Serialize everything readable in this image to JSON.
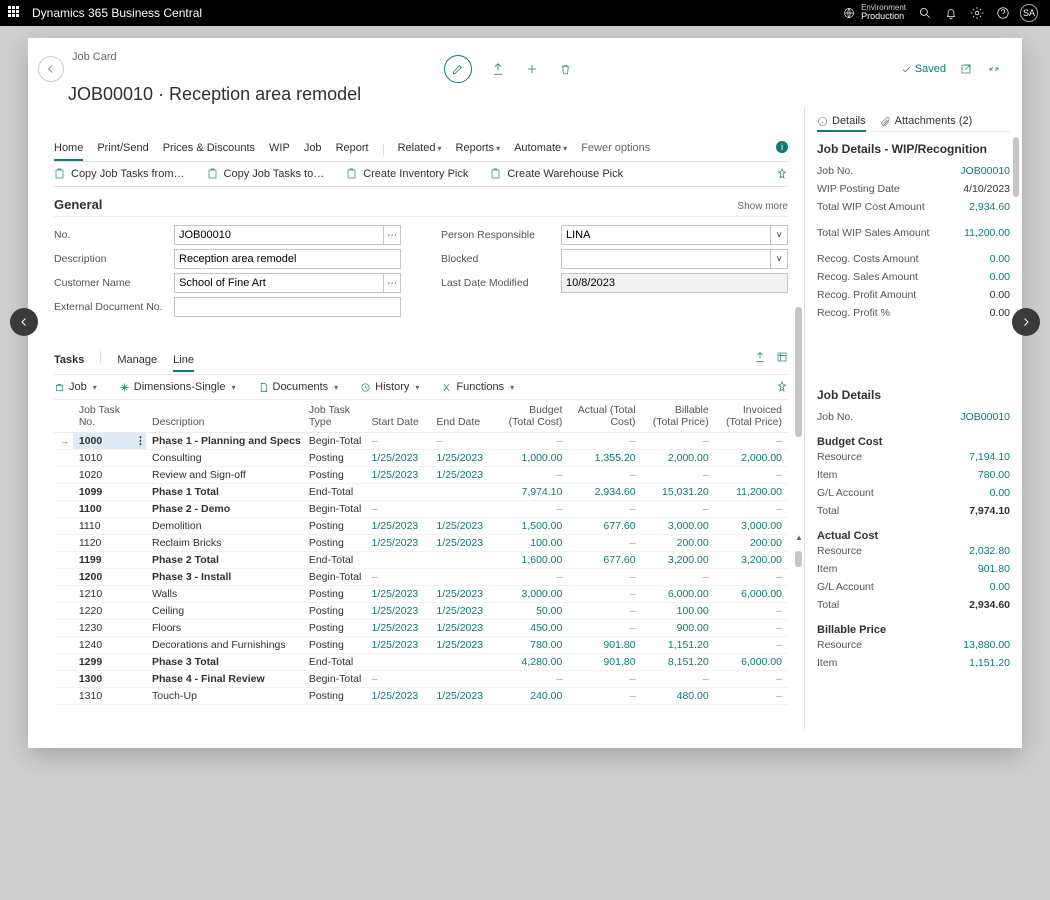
{
  "topbar": {
    "title": "Dynamics 365 Business Central",
    "env_label": "Environment",
    "env_value": "Production",
    "avatar": "SA"
  },
  "header": {
    "breadcrumb": "Job Card",
    "page_title": "JOB00010 · Reception area remodel",
    "saved": "Saved"
  },
  "tabs": [
    "Home",
    "Print/Send",
    "Prices & Discounts",
    "WIP",
    "Job",
    "Report"
  ],
  "tabs_right": [
    "Related",
    "Reports",
    "Automate"
  ],
  "fewer_options": "Fewer options",
  "actions": [
    "Copy Job Tasks from…",
    "Copy Job Tasks to…",
    "Create Inventory Pick",
    "Create Warehouse Pick"
  ],
  "general": {
    "title": "General",
    "show_more": "Show more",
    "no_label": "No.",
    "no_value": "JOB00010",
    "description_label": "Description",
    "description_value": "Reception area remodel",
    "customer_label": "Customer Name",
    "customer_value": "School of Fine Art",
    "ext_doc_label": "External Document No.",
    "ext_doc_value": "",
    "person_label": "Person Responsible",
    "person_value": "LINA",
    "blocked_label": "Blocked",
    "blocked_value": "",
    "last_mod_label": "Last Date Modified",
    "last_mod_value": "10/8/2023"
  },
  "sub_tabs": {
    "tasks": "Tasks",
    "manage": "Manage",
    "line": "Line"
  },
  "tools": [
    "Job",
    "Dimensions-Single",
    "Documents",
    "History",
    "Functions"
  ],
  "grid": {
    "headers": [
      "Job Task No.",
      "Description",
      "Job Task Type",
      "Start Date",
      "End Date",
      "Budget (Total Cost)",
      "Actual (Total Cost)",
      "Billable (Total Price)",
      "Invoiced (Total Price)"
    ],
    "rows": [
      {
        "no": "1000",
        "desc": "Phase 1 - Planning and Specs",
        "type": "Begin-Total",
        "sd": "–",
        "ed": "–",
        "b": "–",
        "a": "–",
        "bi": "–",
        "inv": "–",
        "bold": true,
        "sel": true
      },
      {
        "no": "1010",
        "desc": "Consulting",
        "type": "Posting",
        "sd": "1/25/2023",
        "ed": "1/25/2023",
        "b": "1,000.00",
        "a": "1,355.20",
        "bi": "2,000.00",
        "inv": "2,000.00"
      },
      {
        "no": "1020",
        "desc": "Review and Sign-off",
        "type": "Posting",
        "sd": "1/25/2023",
        "ed": "1/25/2023",
        "b": "–",
        "a": "–",
        "bi": "–",
        "inv": "–"
      },
      {
        "no": "1099",
        "desc": "Phase 1 Total",
        "type": "End-Total",
        "sd": "",
        "ed": "",
        "b": "7,974.10",
        "a": "2,934.60",
        "bi": "15,031.20",
        "inv": "11,200.00",
        "bold": true
      },
      {
        "no": "1100",
        "desc": "Phase 2 - Demo",
        "type": "Begin-Total",
        "sd": "–",
        "ed": "",
        "b": "–",
        "a": "–",
        "bi": "–",
        "inv": "–",
        "bold": true
      },
      {
        "no": "1110",
        "desc": "Demolition",
        "type": "Posting",
        "sd": "1/25/2023",
        "ed": "1/25/2023",
        "b": "1,500.00",
        "a": "677.60",
        "bi": "3,000.00",
        "inv": "3,000.00"
      },
      {
        "no": "1120",
        "desc": "Reclaim Bricks",
        "type": "Posting",
        "sd": "1/25/2023",
        "ed": "1/25/2023",
        "b": "100.00",
        "a": "–",
        "bi": "200.00",
        "inv": "200.00"
      },
      {
        "no": "1199",
        "desc": "Phase 2 Total",
        "type": "End-Total",
        "sd": "",
        "ed": "",
        "b": "1,600.00",
        "a": "677.60",
        "bi": "3,200.00",
        "inv": "3,200.00",
        "bold": true
      },
      {
        "no": "1200",
        "desc": "Phase 3 - Install",
        "type": "Begin-Total",
        "sd": "–",
        "ed": "",
        "b": "–",
        "a": "–",
        "bi": "–",
        "inv": "–",
        "bold": true
      },
      {
        "no": "1210",
        "desc": "Walls",
        "type": "Posting",
        "sd": "1/25/2023",
        "ed": "1/25/2023",
        "b": "3,000.00",
        "a": "–",
        "bi": "6,000.00",
        "inv": "6,000.00"
      },
      {
        "no": "1220",
        "desc": "Ceiling",
        "type": "Posting",
        "sd": "1/25/2023",
        "ed": "1/25/2023",
        "b": "50.00",
        "a": "–",
        "bi": "100.00",
        "inv": "–"
      },
      {
        "no": "1230",
        "desc": "Floors",
        "type": "Posting",
        "sd": "1/25/2023",
        "ed": "1/25/2023",
        "b": "450.00",
        "a": "–",
        "bi": "900.00",
        "inv": "–"
      },
      {
        "no": "1240",
        "desc": "Decorations and Furnishings",
        "type": "Posting",
        "sd": "1/25/2023",
        "ed": "1/25/2023",
        "b": "780.00",
        "a": "901.80",
        "bi": "1,151.20",
        "inv": "–"
      },
      {
        "no": "1299",
        "desc": "Phase 3 Total",
        "type": "End-Total",
        "sd": "",
        "ed": "",
        "b": "4,280.00",
        "a": "901.80",
        "bi": "8,151.20",
        "inv": "6,000.00",
        "bold": true
      },
      {
        "no": "1300",
        "desc": "Phase 4 - Final Review",
        "type": "Begin-Total",
        "sd": "–",
        "ed": "",
        "b": "–",
        "a": "–",
        "bi": "–",
        "inv": "–",
        "bold": true
      },
      {
        "no": "1310",
        "desc": "Touch-Up",
        "type": "Posting",
        "sd": "1/25/2023",
        "ed": "1/25/2023",
        "b": "240.00",
        "a": "–",
        "bi": "480.00",
        "inv": "–"
      }
    ]
  },
  "side": {
    "details_tab": "Details",
    "attachments_tab": "Attachments (2)",
    "wip_title": "Job Details - WIP/Recognition",
    "wip": [
      {
        "k": "Job No.",
        "v": "JOB00010",
        "link": true
      },
      {
        "k": "WIP Posting Date",
        "v": "4/10/2023"
      },
      {
        "k": "Total WIP Cost Amount",
        "v": "2,934.60",
        "link": true
      },
      {
        "k": "Total WIP Sales Amount",
        "v": "11,200.00",
        "link": true,
        "gap": true
      },
      {
        "k": "Recog. Costs Amount",
        "v": "0.00",
        "link": true,
        "gap": true
      },
      {
        "k": "Recog. Sales Amount",
        "v": "0.00",
        "link": true
      },
      {
        "k": "Recog. Profit Amount",
        "v": "0.00"
      },
      {
        "k": "Recog. Profit %",
        "v": "0.00"
      }
    ],
    "jd_title": "Job Details",
    "jd_jobno_k": "Job No.",
    "jd_jobno_v": "JOB00010",
    "budget_title": "Budget Cost",
    "budget": [
      {
        "k": "Resource",
        "v": "7,194.10",
        "link": true
      },
      {
        "k": "Item",
        "v": "780.00",
        "link": true
      },
      {
        "k": "G/L Account",
        "v": "0.00",
        "link": true
      },
      {
        "k": "Total",
        "v": "7,974.10",
        "bold": true
      }
    ],
    "actual_title": "Actual Cost",
    "actual": [
      {
        "k": "Resource",
        "v": "2,032.80",
        "link": true
      },
      {
        "k": "Item",
        "v": "901.80",
        "link": true
      },
      {
        "k": "G/L Account",
        "v": "0.00",
        "link": true
      },
      {
        "k": "Total",
        "v": "2,934.60",
        "bold": true
      }
    ],
    "billable_title": "Billable Price",
    "billable": [
      {
        "k": "Resource",
        "v": "13,880.00",
        "link": true
      },
      {
        "k": "Item",
        "v": "1,151.20",
        "link": true
      }
    ]
  }
}
